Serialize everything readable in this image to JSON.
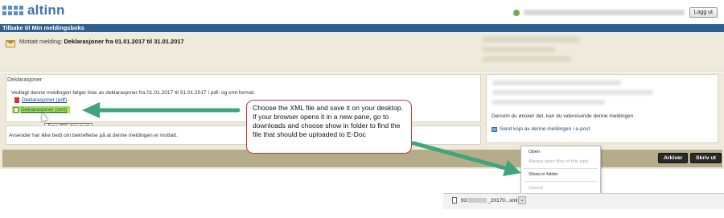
{
  "header": {
    "logo_text": "altinn",
    "logout_label": "Logg ut"
  },
  "nav": {
    "back_link": "Tilbake til Min meldingsboks"
  },
  "message": {
    "title_prefix": "Mottatt melding:",
    "title": "Deklarasjoner fra 01.01.2017 til 31.01.2017"
  },
  "panel": {
    "heading": "Deklarasjoner",
    "description": "Vedlagt denne meldingen følger liste av deklarasjoner fra 01.01.2017 til 31.01.2017 i pdf- og xml-format.",
    "attachments": [
      {
        "label": "Deklarasjoner (pdf)",
        "icon": "pdf-file-icon"
      },
      {
        "label": "Deklarasjoner (xml)",
        "icon": "xml-file-icon"
      }
    ],
    "tooltip": "Åpne PDF-dokument",
    "bottom_text": "Avsender har ikke bedt om bekreftelse på at denne meldingen er mottatt."
  },
  "side": {
    "forward_text": "Dersom du ønsker det, kan du videresende denne meldingen.",
    "email_link": "Send kopi av denne meldingen i e-post"
  },
  "actions": {
    "archive": "Arkiver",
    "print": "Skriv ut"
  },
  "callout": {
    "text": "Choose the XML file and save it on your desktop. If your browser opens it in a new pane, go to downloads and choose show in folder to find the file that should be uploaded to E-Doc"
  },
  "context_menu": {
    "items": [
      {
        "label": "Open",
        "enabled": true
      },
      {
        "label": "Always open files of this type",
        "enabled": false
      },
      {
        "label": "Show in folder",
        "enabled": true
      },
      {
        "label": "Cancel",
        "enabled": false
      }
    ]
  },
  "download": {
    "name_start": "93",
    "name_mid": "_20170...xml",
    "chevron": "⌄"
  },
  "colors": {
    "brand_blue": "#2f5f8d",
    "highlight_green": "#a8e64a",
    "arrow_green": "#3fa57a",
    "callout_border": "#c63a34"
  }
}
